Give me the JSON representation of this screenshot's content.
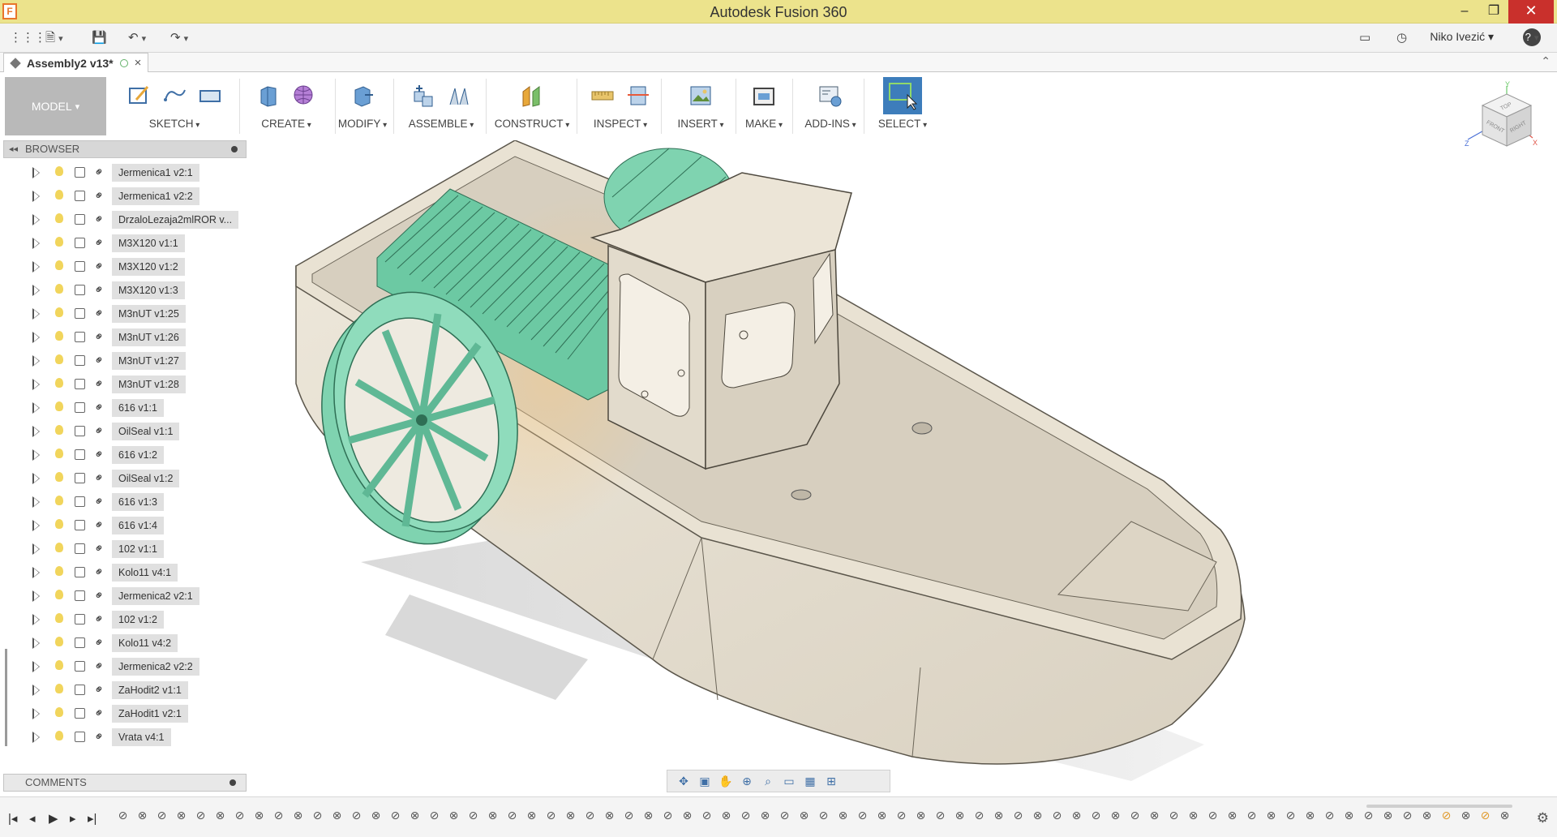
{
  "window": {
    "title": "Autodesk Fusion 360",
    "app_icon": "F",
    "minimize_label": "–",
    "maximize_label": "❐",
    "close_label": "✕"
  },
  "quick_access": {
    "grid_icon": "⋮⋮⋮",
    "file_icon": "🗎",
    "save_icon": "💾",
    "undo_icon": "↶",
    "redo_icon": "↷",
    "comments_icon": "▭",
    "history_icon": "◷",
    "user_name": "Niko Ivezić",
    "help_icon": "?"
  },
  "document_tab": {
    "label": "Assembly2 v13*",
    "close": "×",
    "collapse": "⌃"
  },
  "toolbar": {
    "workspace": "MODEL",
    "groups": [
      {
        "label": "SKETCH"
      },
      {
        "label": "CREATE"
      },
      {
        "label": "MODIFY"
      },
      {
        "label": "ASSEMBLE"
      },
      {
        "label": "CONSTRUCT"
      },
      {
        "label": "INSPECT"
      },
      {
        "label": "INSERT"
      },
      {
        "label": "MAKE"
      },
      {
        "label": "ADD-INS"
      },
      {
        "label": "SELECT"
      }
    ]
  },
  "browser": {
    "title": "BROWSER",
    "collapse_icon": "◂◂",
    "items": [
      {
        "label": "Jermenica1 v2:1"
      },
      {
        "label": "Jermenica1 v2:2"
      },
      {
        "label": "DrzaloLezaja2mlROR v..."
      },
      {
        "label": "M3X120 v1:1"
      },
      {
        "label": "M3X120 v1:2"
      },
      {
        "label": "M3X120 v1:3"
      },
      {
        "label": "M3nUT v1:25"
      },
      {
        "label": "M3nUT v1:26"
      },
      {
        "label": "M3nUT v1:27"
      },
      {
        "label": "M3nUT v1:28"
      },
      {
        "label": "616 v1:1"
      },
      {
        "label": "OilSeal v1:1"
      },
      {
        "label": "616 v1:2"
      },
      {
        "label": "OilSeal v1:2"
      },
      {
        "label": "616 v1:3"
      },
      {
        "label": "616 v1:4"
      },
      {
        "label": "102 v1:1"
      },
      {
        "label": "Kolo11 v4:1"
      },
      {
        "label": "Jermenica2 v2:1"
      },
      {
        "label": "102 v1:2"
      },
      {
        "label": "Kolo11 v4:2"
      },
      {
        "label": "Jermenica2 v2:2"
      },
      {
        "label": "ZaHodit2 v1:1"
      },
      {
        "label": "ZaHodit1 v2:1"
      },
      {
        "label": "Vrata v4:1"
      }
    ]
  },
  "comments": {
    "title": "COMMENTS"
  },
  "viewcube": {
    "top": "TOP",
    "front": "FRONT",
    "right": "RIGHT",
    "axis_x": "X",
    "axis_y": "Y",
    "axis_z": "Z"
  },
  "navbar": {
    "icons": [
      "orbit-icon",
      "look-at-icon",
      "pan-icon",
      "zoom-icon",
      "fit-icon",
      "display-settings-icon",
      "grid-icon",
      "viewports-icon"
    ]
  },
  "timeline": {
    "controls": [
      "|◂",
      "◂",
      "▶",
      "▸",
      "▸|"
    ],
    "feature_count": 72
  },
  "colors": {
    "title_bar": "#ece38c",
    "accent_blue": "#3d7dbb",
    "part_green": "#6cc9a3",
    "part_beige": "#e8e1d4"
  }
}
